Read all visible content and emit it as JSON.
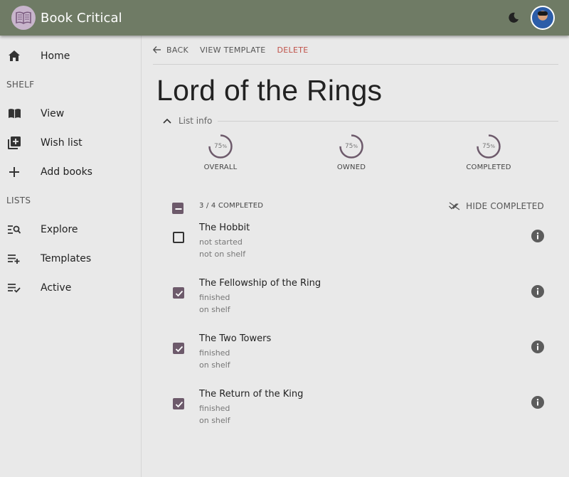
{
  "app": {
    "title": "Book Critical",
    "logo_icon": "open-book-icon",
    "theme_icon": "moon-icon",
    "accent": "#6f7b65"
  },
  "sidebar": {
    "home": {
      "label": "Home",
      "icon": "home-icon"
    },
    "shelf_section": "SHELF",
    "shelf_items": [
      {
        "label": "View",
        "icon": "book-open-icon"
      },
      {
        "label": "Wish list",
        "icon": "library-add-icon"
      },
      {
        "label": "Add books",
        "icon": "plus-icon"
      }
    ],
    "lists_section": "LISTS",
    "list_items": [
      {
        "label": "Explore",
        "icon": "list-search-icon"
      },
      {
        "label": "Templates",
        "icon": "playlist-add-icon"
      },
      {
        "label": "Active",
        "icon": "playlist-check-icon"
      }
    ]
  },
  "actions": {
    "back": "BACK",
    "view_template": "VIEW TEMPLATE",
    "delete": "DELETE",
    "delete_color": "#c0524a"
  },
  "page": {
    "title": "Lord of the Rings"
  },
  "list_info": {
    "label": "List info"
  },
  "stats": [
    {
      "label": "OVERALL",
      "value": "75",
      "unit": "%",
      "fraction": 0.75
    },
    {
      "label": "OWNED",
      "value": "75",
      "unit": "%",
      "fraction": 0.75
    },
    {
      "label": "COMPLETED",
      "value": "75",
      "unit": "%",
      "fraction": 0.75
    }
  ],
  "list": {
    "completed_summary": "3 / 4 COMPLETED",
    "hide_completed_label": "HIDE COMPLETED",
    "check_color": "#6d5a6b",
    "books": [
      {
        "title": "The Hobbit",
        "status": "not started",
        "shelf": "not on shelf",
        "checked": false
      },
      {
        "title": "The Fellowship of the Ring",
        "status": "finished",
        "shelf": "on shelf",
        "checked": true
      },
      {
        "title": "The Two Towers",
        "status": "finished",
        "shelf": "on shelf",
        "checked": true
      },
      {
        "title": "The Return of the King",
        "status": "finished",
        "shelf": "on shelf",
        "checked": true
      }
    ]
  }
}
